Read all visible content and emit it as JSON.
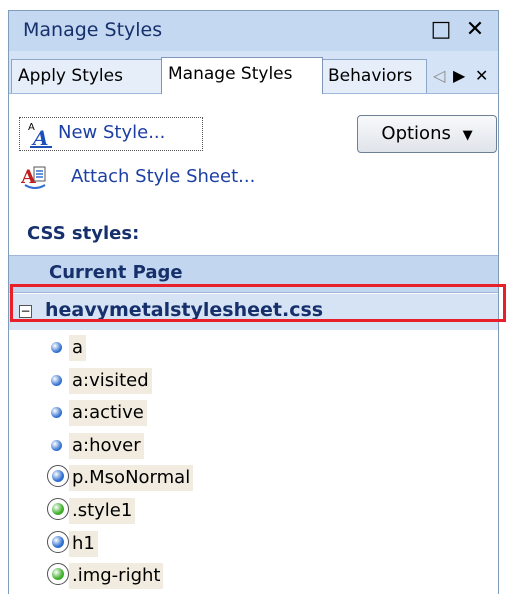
{
  "window": {
    "title": "Manage Styles",
    "maximize_glyph": "□",
    "close_glyph": "✕"
  },
  "tabs": [
    {
      "label": "Apply Styles"
    },
    {
      "label": "Manage Styles"
    },
    {
      "label": "Behaviors"
    }
  ],
  "tab_nav": {
    "left": "◁",
    "right": "▶",
    "close": "✕"
  },
  "toolbar": {
    "new_style_label": "New Style...",
    "options_label": "Options",
    "options_arrow": "▼",
    "attach_label": "Attach Style Sheet..."
  },
  "css_styles_label": "CSS styles:",
  "group_header": "Current Page",
  "stylesheet": {
    "name": "heavymetalstylesheet.css",
    "expander": "−"
  },
  "styles": [
    {
      "name": "a",
      "icon": "blue-dot"
    },
    {
      "name": "a:visited",
      "icon": "blue-dot"
    },
    {
      "name": "a:active",
      "icon": "blue-dot"
    },
    {
      "name": "a:hover",
      "icon": "blue-dot"
    },
    {
      "name": "p.MsoNormal",
      "icon": "blue-ring"
    },
    {
      "name": ".style1",
      "icon": "green-ring"
    },
    {
      "name": "h1",
      "icon": "blue-ring"
    },
    {
      "name": ".img-right",
      "icon": "green-ring"
    }
  ],
  "colors": {
    "highlight": "#e8202a",
    "blue": "#2f6fd0",
    "green": "#3fae2a"
  }
}
